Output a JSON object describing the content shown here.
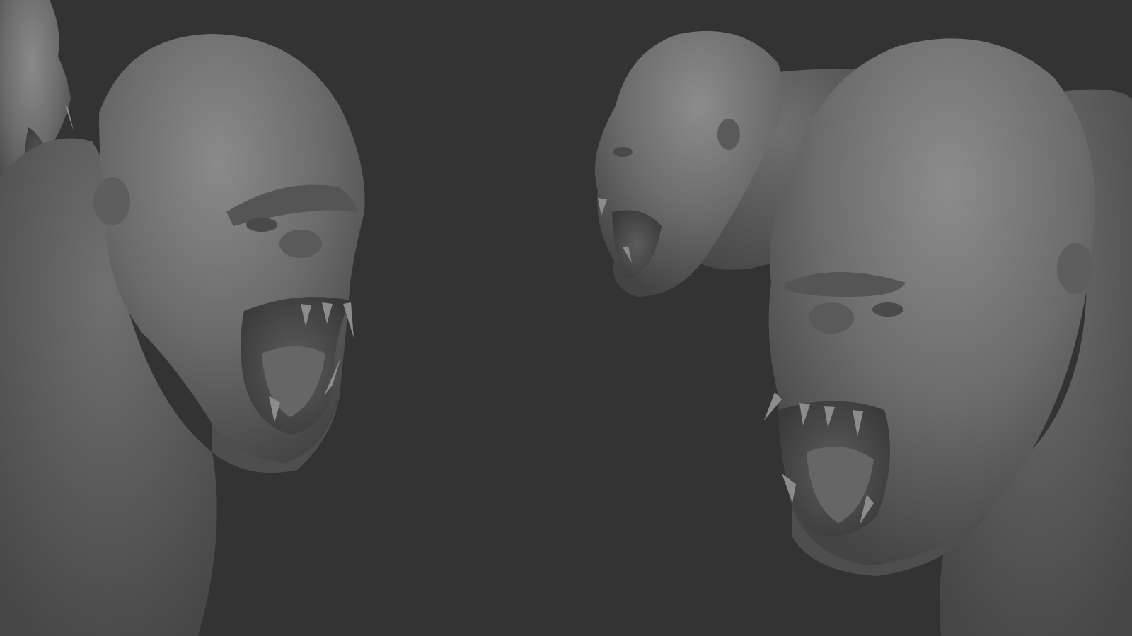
{
  "scene": {
    "background_color": "#333333",
    "sculpt_base_color": "#6a6a6a",
    "sculpt_highlight_color": "#8a8a8a",
    "sculpt_shadow_color": "#3c3c3c",
    "mouth_interior_color": "#4a4a4a",
    "tooth_color": "#8c8c8c",
    "subjects": [
      {
        "name": "roaring-ape-left-large",
        "facing": "right"
      },
      {
        "name": "roaring-ape-left-small-partial",
        "facing": "left"
      },
      {
        "name": "roaring-ape-right-small",
        "facing": "left"
      },
      {
        "name": "roaring-ape-right-large",
        "facing": "left"
      }
    ]
  }
}
